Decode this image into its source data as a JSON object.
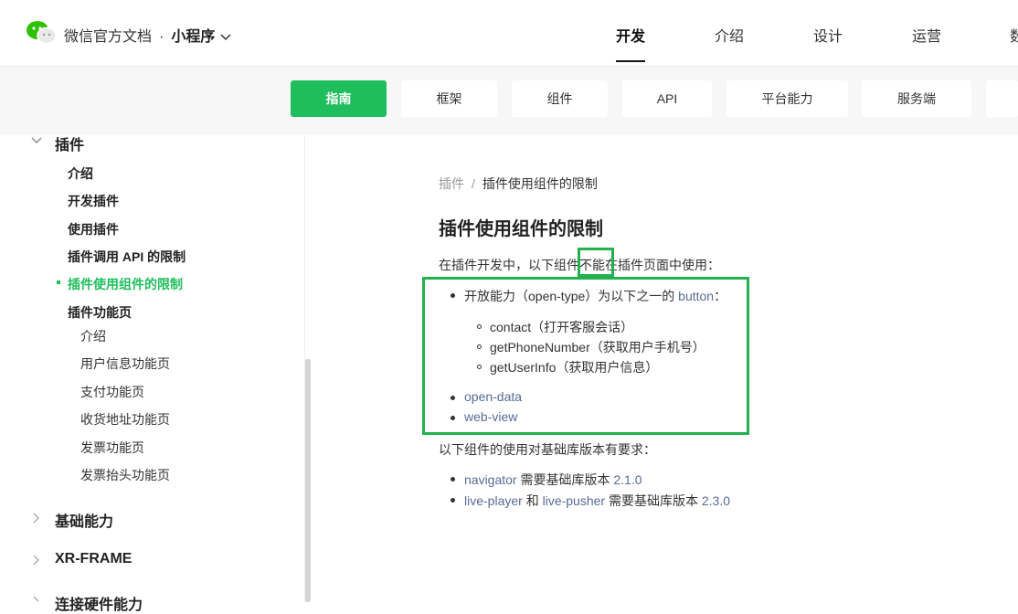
{
  "header": {
    "brand": "微信官方文档",
    "separator": "·",
    "product": "小程序",
    "nav": [
      "开发",
      "介绍",
      "设计",
      "运营",
      "数"
    ]
  },
  "subnav": [
    "指南",
    "框架",
    "组件",
    "API",
    "平台能力",
    "服务端",
    ""
  ],
  "sidebar": {
    "section_plugin": "插件",
    "items": [
      "介绍",
      "开发插件",
      "使用插件",
      "插件调用 API 的限制",
      "插件使用组件的限制",
      "插件功能页"
    ],
    "sub_items": [
      "介绍",
      "用户信息功能页",
      "支付功能页",
      "收货地址功能页",
      "发票功能页",
      "发票抬头功能页"
    ],
    "sections_collapsed": [
      "基础能力",
      "XR-FRAME",
      "连接硬件能力"
    ]
  },
  "content": {
    "breadcrumb_root": "插件",
    "breadcrumb_sep": "/",
    "breadcrumb_current": "插件使用组件的限制",
    "title": "插件使用组件的限制",
    "intro": "在插件开发中，以下组件不能在插件页面中使用：",
    "list1": {
      "item1_text": "开放能力（open-type）为以下之一的",
      "item1_link": "button",
      "item1_tail": "：",
      "subitems": [
        "contact（打开客服会话）",
        "getPhoneNumber（获取用户手机号）",
        "getUserInfo（获取用户信息）"
      ],
      "item2_link": "open-data",
      "item3_link": "web-view"
    },
    "para2": "以下组件的使用对基础库版本有要求：",
    "list2": {
      "a_link": "navigator",
      "a_text": "需要基础库版本",
      "a_ver": "2.1.0",
      "b_link1": "live-player",
      "b_and": "和",
      "b_link2": "live-pusher",
      "b_text": "需要基础库版本",
      "b_ver": "2.3.0"
    }
  }
}
